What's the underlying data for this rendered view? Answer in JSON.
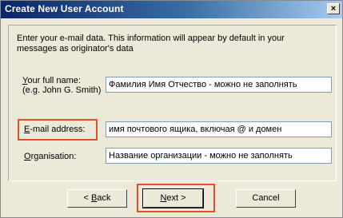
{
  "window": {
    "title": "Create New User Account",
    "close_glyph": "×"
  },
  "intro": {
    "line1": "Enter your e-mail data. This information will appear by default in your",
    "line2": "messages as originator's data"
  },
  "full_name": {
    "label_accel": "Y",
    "label_rest": "our full name:",
    "hint": "(e.g. John G. Smith)",
    "value": "Фамилия Имя Отчество - можно не заполнять"
  },
  "email": {
    "label_accel": "E",
    "label_rest": "-mail address:",
    "value": "имя почтового ящика, включая @ и домен"
  },
  "organisation": {
    "label_accel": "O",
    "label_rest": "rganisation:",
    "value": "Название организации - можно не заполнять"
  },
  "buttons": {
    "back_prefix": "< ",
    "back_accel": "B",
    "back_rest": "ack",
    "next_accel": "N",
    "next_rest": "ext  >",
    "cancel": "Cancel"
  },
  "highlight_color": "#e84d2a",
  "title_bar_colors": [
    "#0a246a",
    "#a6caf0"
  ]
}
